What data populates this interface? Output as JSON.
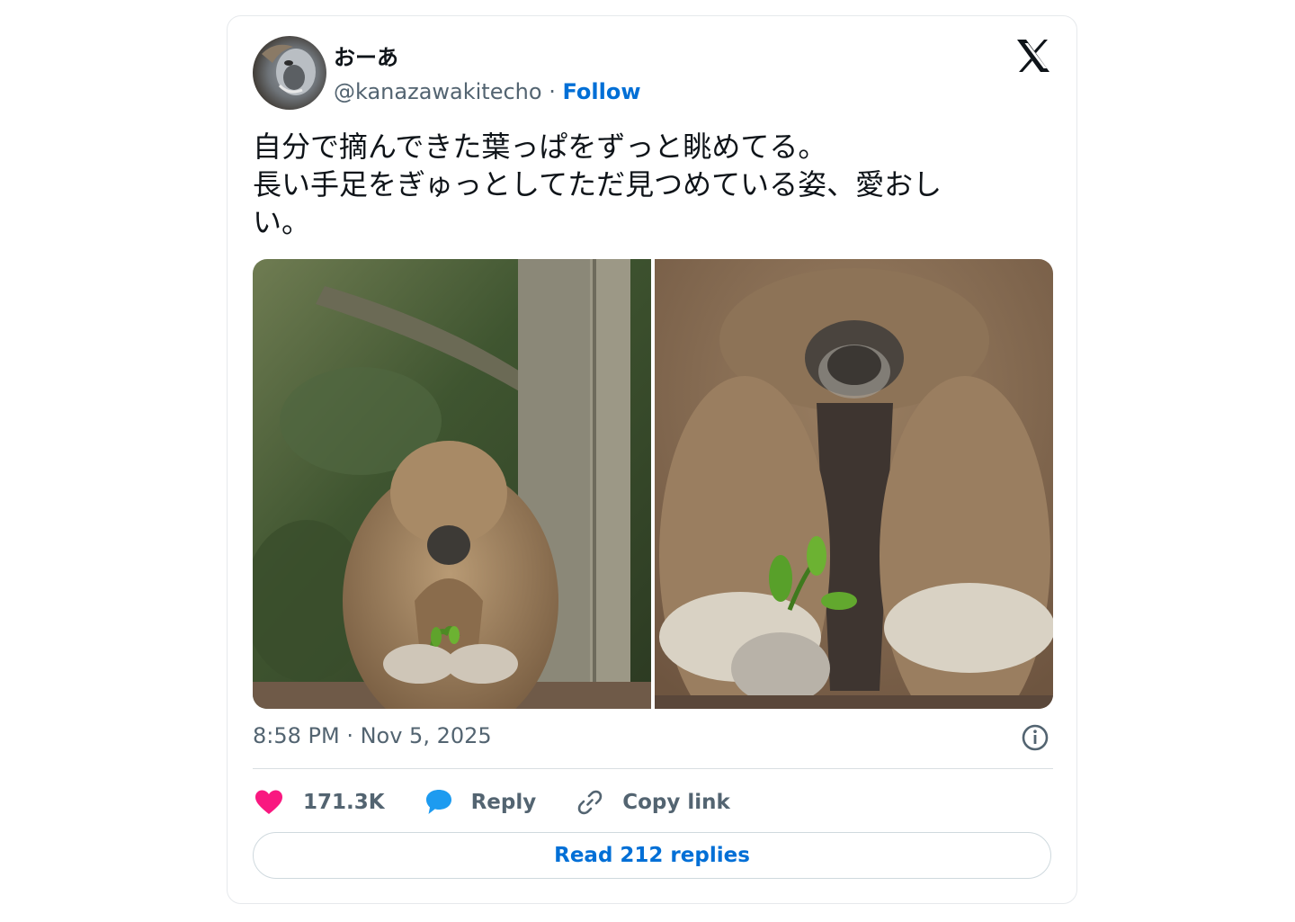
{
  "author": {
    "name": "おーあ",
    "handle": "@kanazawakitecho",
    "separator": " · ",
    "follow_label": "Follow"
  },
  "tweet": {
    "text": "自分で摘んできた葉っぱをずっと眺めてる。\n長い手足をぎゅっとしてただ見つめている姿、愛おし\nい。",
    "timestamp": "8:58 PM · Nov 5, 2025"
  },
  "media": [
    {
      "name": "gibbon-photo-wide",
      "description_icon": "photo"
    },
    {
      "name": "gibbon-photo-closeup",
      "description_icon": "photo"
    }
  ],
  "actions": {
    "like_count": "171.3K",
    "reply_label": "Reply",
    "copy_link_label": "Copy link"
  },
  "read_replies_label": "Read 212 replies",
  "icons": {
    "logo": "x-logo-icon",
    "info": "info-icon",
    "like": "heart-icon",
    "reply": "speech-bubble-icon",
    "copy": "link-icon"
  },
  "colors": {
    "link_blue": "#006fd6",
    "like_pink": "#f91880",
    "reply_blue": "#1d9bf0",
    "muted_text": "#536471"
  }
}
